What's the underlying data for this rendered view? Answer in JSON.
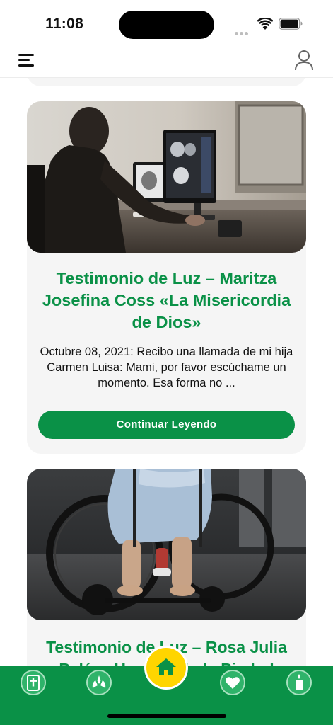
{
  "status_bar": {
    "time": "11:08"
  },
  "header": {
    "menu_icon": "hamburger-menu-icon",
    "profile_icon": "user-profile-icon"
  },
  "articles": [
    {
      "title": "Testimonio de Luz – Maritza Josefina Coss «La Misericordia de Dios»",
      "excerpt": "Octubre 08, 2021: Recibo una llamada de mi hija Carmen Luisa: Mami, por favor escúchame un momento.  Esa forma no ...",
      "button_label": "Continuar Leyendo",
      "image": "woman-at-medical-monitors-photo"
    },
    {
      "title": "Testimonio de Luz – Rosa Julia Peláez Huertas de la Piedad",
      "image": "wheelchair-patient-photo"
    }
  ],
  "tab_bar": {
    "items": [
      {
        "icon": "bible-icon"
      },
      {
        "icon": "praying-hands-icon"
      },
      {
        "icon": "home-icon"
      },
      {
        "icon": "heart-icon"
      },
      {
        "icon": "candle-icon"
      }
    ]
  },
  "colors": {
    "accent": "#0a9147",
    "home": "#ffd500",
    "card_bg": "#f5f5f5"
  }
}
